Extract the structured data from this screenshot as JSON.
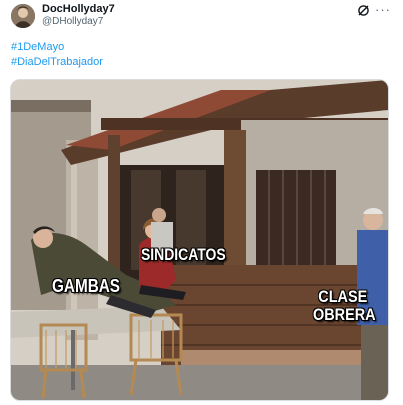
{
  "tweet": {
    "display_name": "DocHollyday7",
    "handle": "@DHollyday7",
    "more_glyph": "···",
    "hashtags": [
      "#1DeMayo",
      "#DiaDelTrabajador"
    ]
  },
  "meme": {
    "labels": {
      "center": "SINDICATOS",
      "left": "GAMBAS",
      "right": "CLASE\nOBRERA"
    }
  },
  "icons": {
    "grok": "grok-icon",
    "more": "more-options-icon",
    "avatar": "avatar"
  },
  "colors": {
    "link": "#1d9bf0",
    "name": "#0f1419",
    "secondary": "#536471"
  }
}
